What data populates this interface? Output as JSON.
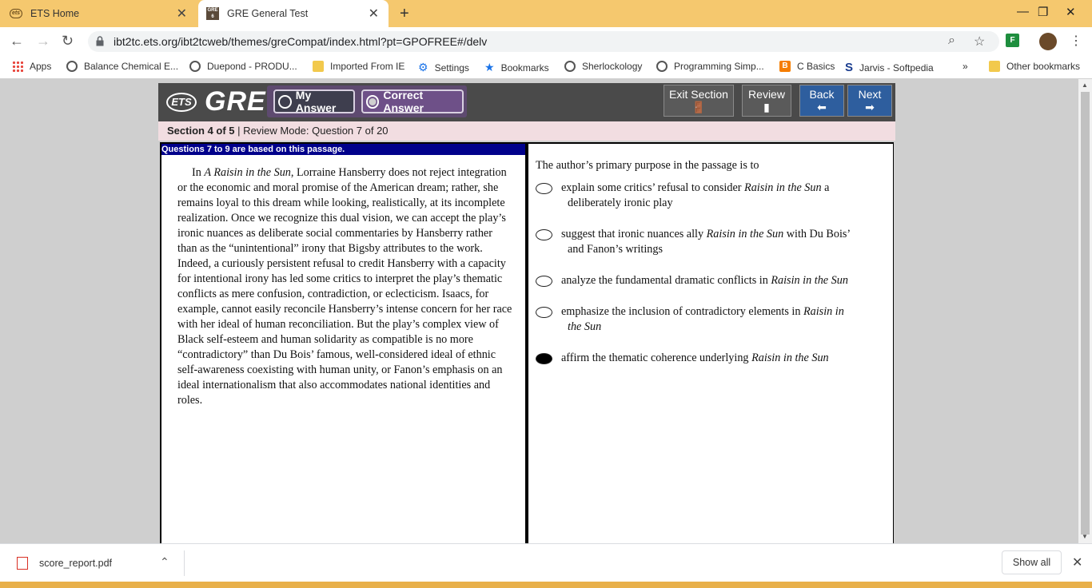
{
  "browser": {
    "tabs": [
      {
        "label": "ETS Home"
      },
      {
        "label": "GRE General Test"
      }
    ],
    "url": "ibt2tc.ets.org/ibt2tcweb/themes/greCompat/index.html?pt=GPOFREE#/delv",
    "bookmarks": [
      {
        "label": "Apps"
      },
      {
        "label": "Balance Chemical E..."
      },
      {
        "label": "Duepond - PRODU..."
      },
      {
        "label": "Imported From IE"
      },
      {
        "label": "Settings"
      },
      {
        "label": "Bookmarks"
      },
      {
        "label": "Sherlockology"
      },
      {
        "label": "Programming Simp..."
      },
      {
        "label": "C Basics"
      },
      {
        "label": "Jarvis - Softpedia"
      },
      {
        "label": "Other bookmarks"
      }
    ],
    "overflow": "»"
  },
  "gre": {
    "ets_logo": "ETS",
    "gre_logo": "GRE",
    "my_answer_label": "My Answer",
    "correct_answer_label": "Correct Answer",
    "exit_label": "Exit Section",
    "review_label": "Review",
    "back_label": "Back",
    "next_label": "Next",
    "section": "Section 4 of 5",
    "mode": "| Review Mode: Question 7 of 20",
    "passage_header": "Questions 7 to 9 are based on this passage.",
    "passage": {
      "p1": "In",
      "title": "A Raisin in the Sun",
      "p2": ", Lorraine Hansberry does not reject integration or the economic and moral promise of the American dream; rather, she remains loyal to this dream while looking, realistically, at its incomplete realization. Once we recognize this dual vision, we can accept the play’s ironic nuances as deliberate social commentaries by Hansberry rather than as the “unintentional” irony that Bigsby attributes to the work. Indeed, a curiously persistent refusal to credit Hansberry with a capacity for intentional irony has led some critics to interpret the play’s thematic conflicts as mere confusion, contradiction, or eclecticism. Isaacs, for example, cannot easily reconcile Hansberry’s intense concern for her race with her ideal of human reconciliation. But the play’s complex view of Black self-esteem and human solidarity as compatible is no more “contradictory” than Du Bois’ famous, well-considered ideal of ethnic self-awareness coexisting with human unity, or Fanon’s emphasis on an ideal internationalism that also accommodates national identities and roles."
    },
    "question": "The author’s primary purpose in the passage is to",
    "choices": [
      {
        "before": "explain some critics’ refusal to consider",
        "title": "Raisin in the Sun",
        "after": "a",
        "line2": "deliberately ironic play",
        "selected": false
      },
      {
        "before": "suggest that ironic nuances ally",
        "title": "Raisin in the Sun",
        "after": "with Du Bois’",
        "line2": "and Fanon’s writings",
        "selected": false
      },
      {
        "before": "analyze the fundamental dramatic conflicts in",
        "title": "Raisin in the Sun",
        "after": "",
        "line2": "",
        "selected": false
      },
      {
        "before": "emphasize the inclusion of contradictory elements in",
        "title": "Raisin in",
        "after": "",
        "line2": "the Sun",
        "selected": false
      },
      {
        "before": "affirm the thematic coherence underlying",
        "title": "Raisin in the Sun",
        "after": "",
        "line2": "",
        "selected": true
      }
    ]
  },
  "downloads": {
    "file": "score_report.pdf",
    "show_all": "Show all"
  },
  "colors": {
    "tab_strip": "#f5c86e",
    "gre_header": "#4a4a4a",
    "answer_group": "#5e4a70",
    "nav_blue": "#2e5e9e",
    "section_bar": "#f2dde1",
    "passage_header": "#00008b"
  }
}
